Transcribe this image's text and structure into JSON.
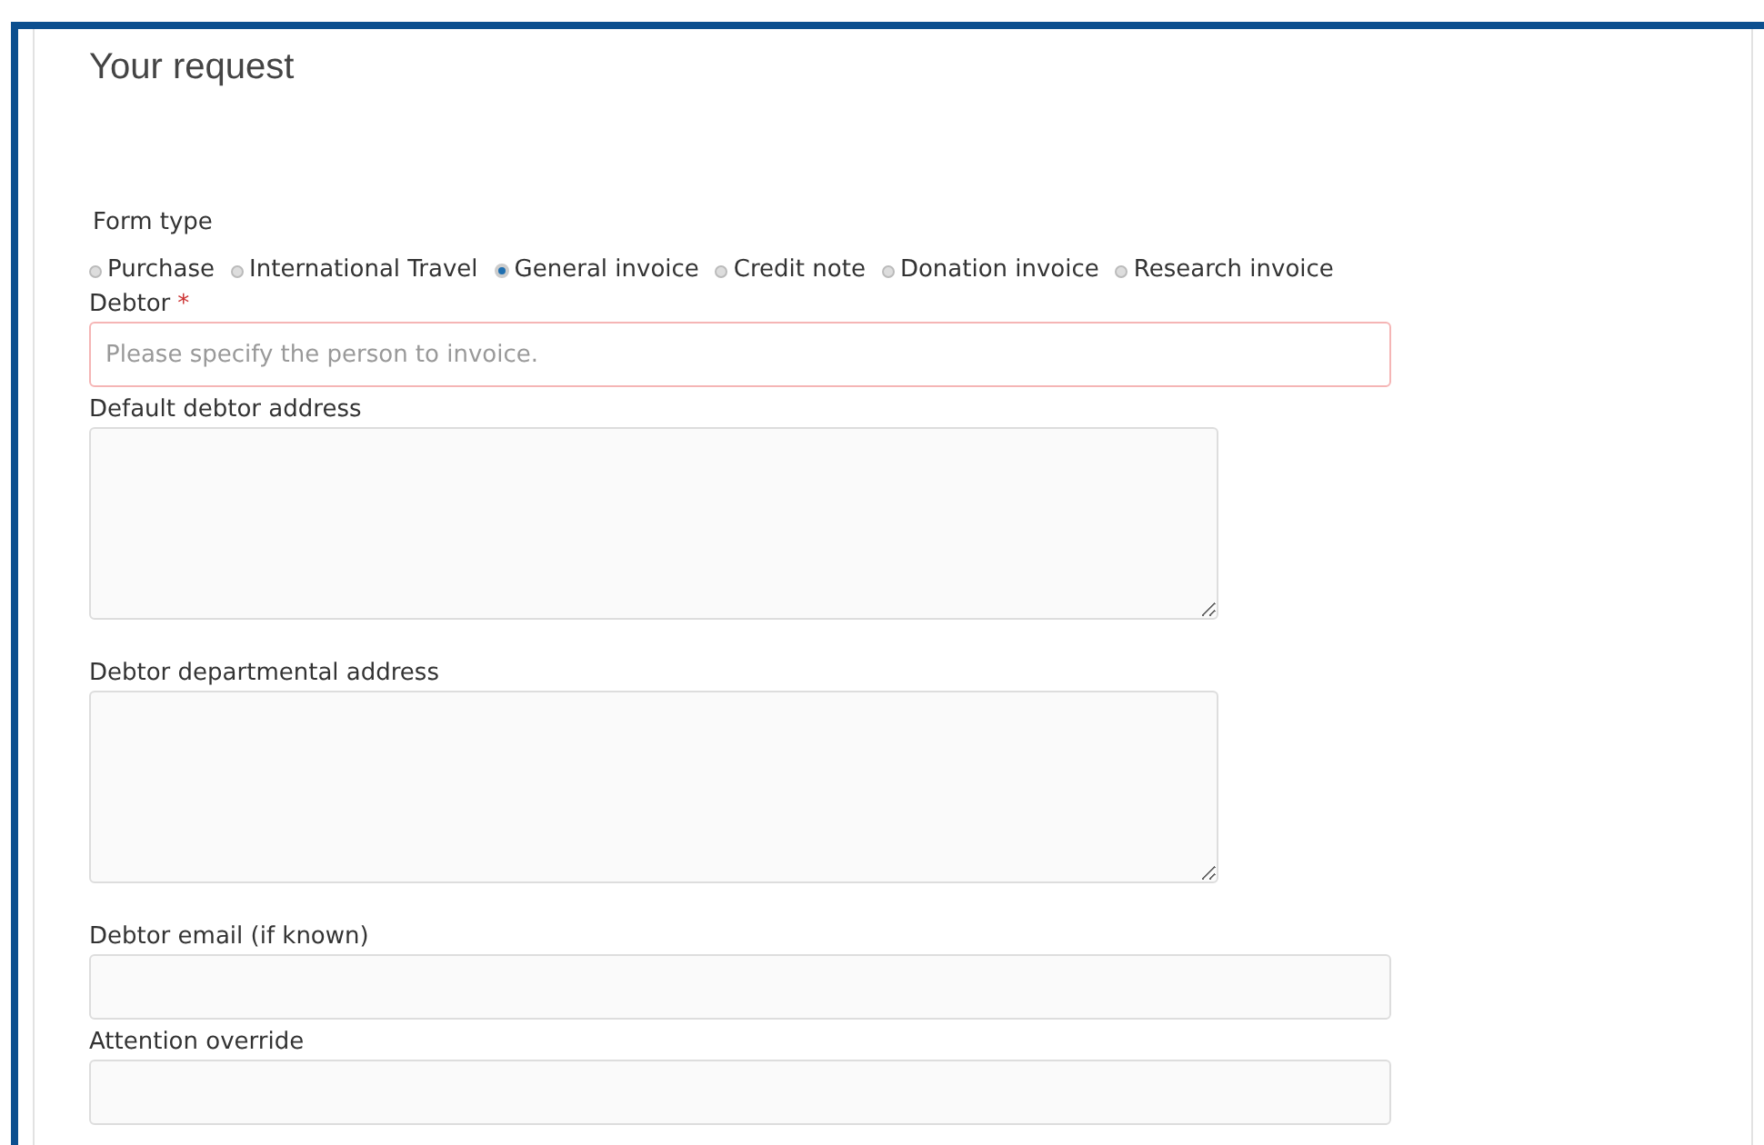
{
  "title": "Your request",
  "form_type": {
    "label": "Form type",
    "options": [
      {
        "label": "Purchase",
        "selected": false
      },
      {
        "label": "International Travel",
        "selected": false
      },
      {
        "label": "General invoice",
        "selected": true
      },
      {
        "label": "Credit note",
        "selected": false
      },
      {
        "label": "Donation invoice",
        "selected": false
      },
      {
        "label": "Research invoice",
        "selected": false
      }
    ]
  },
  "fields": [
    {
      "kind": "text",
      "label": "Debtor",
      "required_mark": "*",
      "placeholder": "Please specify the person to invoice."
    },
    {
      "kind": "textarea",
      "label": "Default debtor address"
    },
    {
      "kind": "textarea",
      "label": "Debtor departmental address"
    },
    {
      "kind": "text",
      "label": "Debtor email (if known)"
    },
    {
      "kind": "text",
      "label": "Attention override"
    }
  ]
}
